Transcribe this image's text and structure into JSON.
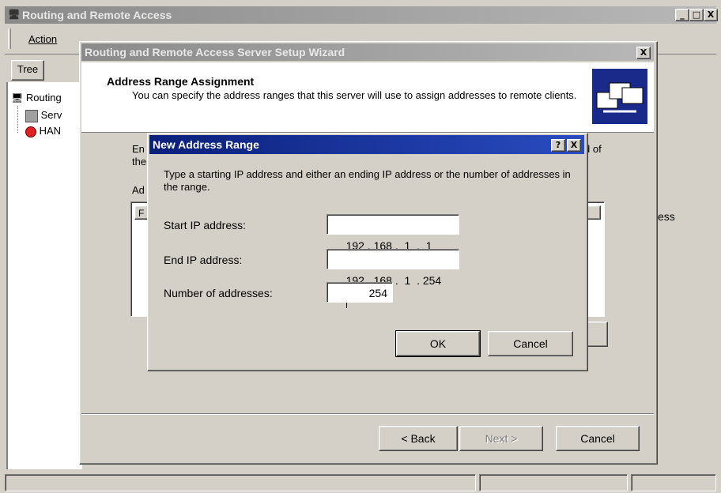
{
  "main_window": {
    "title": "Routing and Remote Access",
    "menu_action": "Action",
    "tree_tab": "Tree",
    "tree_items": [
      "Routing",
      "Serv",
      "HAN"
    ],
    "partial_text": "ess",
    "caption_buttons": [
      "_",
      "□",
      "X"
    ]
  },
  "wizard": {
    "title": "Routing and Remote Access Server Setup Wizard",
    "close": "X",
    "header_title": "Address Range Assignment",
    "header_desc": "You can specify the address ranges that this server will use to assign addresses to remote clients.",
    "partial_left_1": "En",
    "partial_left_2": "the",
    "partial_left_3": "Ad",
    "partial_list_header": "F",
    "partial_right_1": "d of",
    "buttons": {
      "back": "< Back",
      "next": "Next >",
      "cancel": "Cancel"
    }
  },
  "dialog": {
    "title": "New Address Range",
    "help": "?",
    "close": "X",
    "instructions": "Type a starting IP address and either an ending IP address or the number of addresses in the range.",
    "start_label": "Start IP address:",
    "start_value": "192 . 168 .  1  .  1",
    "end_label": "End IP address:",
    "end_value": "192 . 168 .  1  . 254",
    "count_label": "Number of addresses:",
    "count_value": "254",
    "ok": "OK",
    "cancel": "Cancel"
  }
}
